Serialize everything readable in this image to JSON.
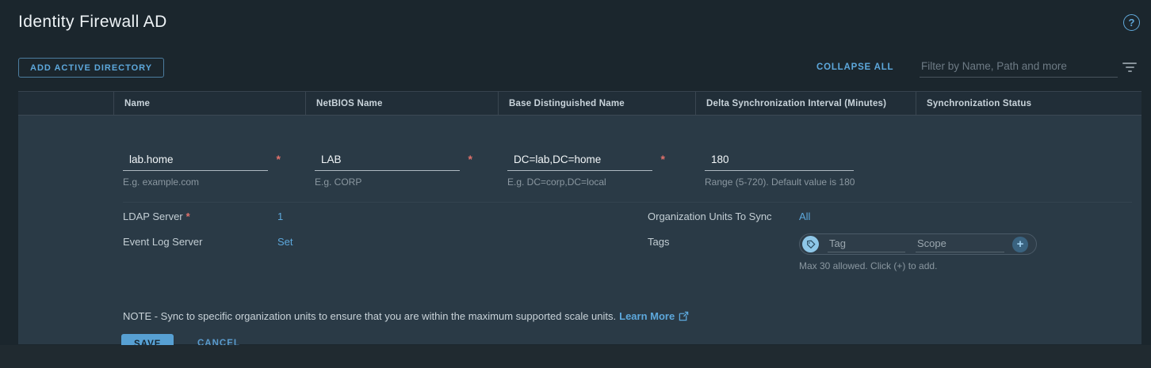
{
  "page": {
    "title": "Identity Firewall AD",
    "help_icon_glyph": "?"
  },
  "toolbar": {
    "add_button_label": "ADD ACTIVE DIRECTORY",
    "collapse_all_label": "COLLAPSE ALL",
    "filter_placeholder": "Filter by Name, Path and more"
  },
  "table": {
    "columns": [
      "Name",
      "NetBIOS Name",
      "Base Distinguished Name",
      "Delta Synchronization Interval (Minutes)",
      "Synchronization Status"
    ]
  },
  "form": {
    "required_marker": "*",
    "fields": [
      {
        "value": "lab.home",
        "hint": "E.g. example.com"
      },
      {
        "value": "LAB",
        "hint": "E.g. CORP"
      },
      {
        "value": "DC=lab,DC=home",
        "hint": "E.g. DC=corp,DC=local"
      },
      {
        "value": "180",
        "hint": "Range (5-720). Default value is 180"
      }
    ],
    "ldap_server": {
      "label": "LDAP Server",
      "value": "1"
    },
    "event_log_server": {
      "label": "Event Log Server",
      "value": "Set"
    },
    "org_units": {
      "label": "Organization Units To Sync",
      "value": "All"
    },
    "tags": {
      "label": "Tags",
      "tag_placeholder": "Tag",
      "scope_placeholder": "Scope",
      "add_glyph": "+",
      "hint": "Max 30 allowed. Click (+) to add."
    },
    "note_text": "NOTE - Sync to specific organization units to ensure that you are within the maximum supported scale units.",
    "learn_more_label": "Learn More",
    "save_label": "SAVE",
    "cancel_label": "CANCEL"
  },
  "colors": {
    "accent": "#5da8dc",
    "save_button_bg": "#57a0d3",
    "required_asterisk": "#e0716b",
    "page_bg": "#1b262d",
    "row_bg": "#2a3a46"
  }
}
